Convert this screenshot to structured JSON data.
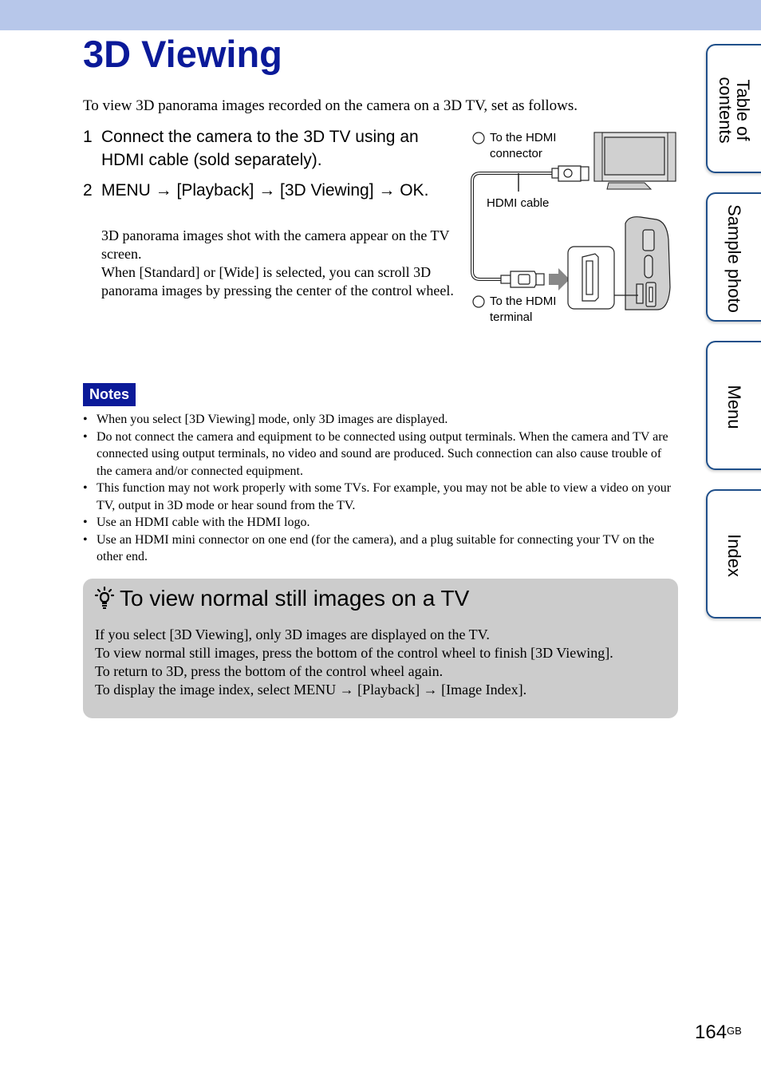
{
  "header": {
    "bar_color": "#b7c7ea"
  },
  "title": "3D Viewing",
  "intro": "To view 3D panorama images recorded on the camera on a 3D TV, set as follows.",
  "steps": [
    {
      "number": "1",
      "text": "Connect the camera to the 3D TV using an HDMI cable (sold separately)."
    },
    {
      "number": "2",
      "text": "MENU → [Playback] → [3D Viewing] → OK."
    }
  ],
  "step_body": [
    "3D panorama images shot with the camera appear on the TV screen.",
    "When [Standard] or [Wide] is selected, you can scroll 3D panorama images by pressing the center of the control wheel."
  ],
  "diagram": {
    "label1": "① To the HDMI\nconnector",
    "cable_label": "HDMI cable",
    "label2": "② To the HDMI\nterminal"
  },
  "notes": {
    "badge": "Notes",
    "items": [
      "When you select [3D Viewing] mode, only 3D images are displayed.",
      "Do not connect the camera and equipment to be connected using output terminals. When the camera and TV are connected using output terminals, no video and sound are produced. Such connection can also cause trouble of the camera and/or connected equipment.",
      "This function may not work properly with some TVs. For example, you may not be able to view a video on your TV, output in 3D mode or hear sound from the TV.",
      "Use an HDMI cable with the HDMI logo.",
      "Use an HDMI mini connector on one end (for the camera), and a plug suitable for connecting your TV on the other end."
    ]
  },
  "hint": {
    "icon": "lightbulb-icon",
    "title": "To view normal still images on a TV",
    "lines": [
      "If you select [3D Viewing], only 3D images are displayed on the TV.",
      "To view normal still images, press the bottom of the control wheel to finish [3D Viewing].",
      "To return to 3D, press the bottom of the control wheel again.",
      "To display the image index, select MENU → [Playback] → [Image Index]."
    ]
  },
  "side_tabs": [
    {
      "label": "Table of\ncontents"
    },
    {
      "label": "Sample photo"
    },
    {
      "label": "Menu"
    },
    {
      "label": "Index"
    }
  ],
  "page": {
    "number": "164",
    "suffix": "GB"
  },
  "colors": {
    "title": "#0b1a99",
    "notes_badge": "#0b1a99",
    "tab_border": "#1f4f8a",
    "hint_bg": "#cccccc"
  }
}
